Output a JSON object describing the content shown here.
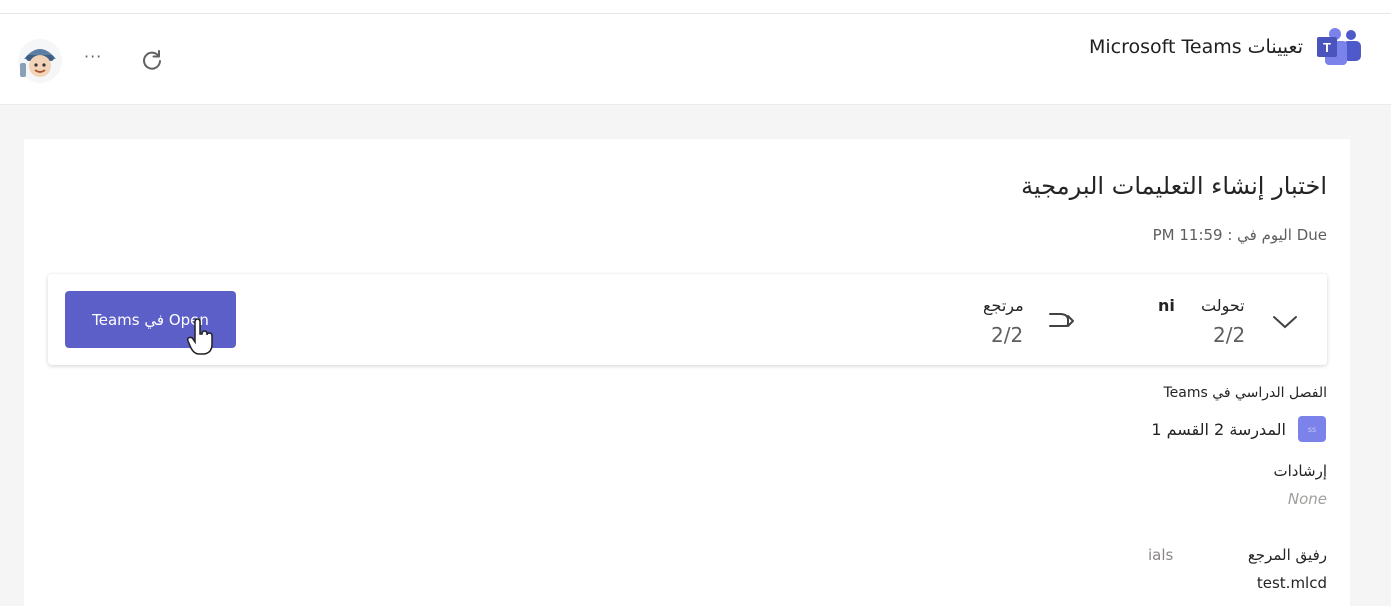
{
  "header": {
    "app_title": "تعيينات Microsoft Teams",
    "more_label": "···"
  },
  "assignment": {
    "title": "اختبار إنشاء التعليمات البرمجية",
    "due_text": "Due اليوم في : 11:59 PM"
  },
  "status": {
    "turned_in_label": "تحولت",
    "turned_in_extra": "ni",
    "turned_in_value": "2/2",
    "returned_label": "مرتجع",
    "returned_value": "2/2"
  },
  "open_button": {
    "label": "Open في Teams"
  },
  "class_section": {
    "label": "الفصل الدراسي في Teams",
    "badge_text": "ss",
    "class_name": "المدرسة 2 القسم 1"
  },
  "instructions": {
    "label": "إرشادات",
    "value": "None"
  },
  "rubric": {
    "label": "رفيق المرجع",
    "extra": "ials",
    "value": "test.mlcd"
  },
  "colors": {
    "accent": "#5b5fc7",
    "teams_purple": "#7b83eb",
    "content_bg": "#f5f5f5"
  }
}
